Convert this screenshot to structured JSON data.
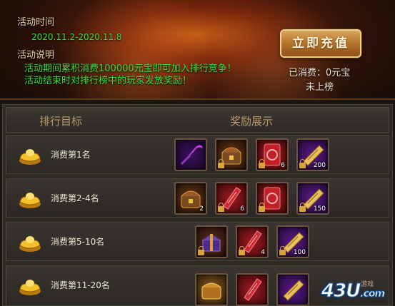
{
  "banner": {
    "time_title": "活动时间",
    "time_range": "2020.11.2-2020.11.8",
    "desc_title": "活动说明",
    "desc_line1": "活动期间累积消费100000元宝即可加入排行竞争！",
    "desc_line2": "活动结束时对排行榜中的玩家发放奖励！",
    "recharge_label": "立即充值",
    "spent_text": "已消费：0元宝",
    "rank_status": "未上榜"
  },
  "table": {
    "col_target": "排行目标",
    "col_reward": "奖励展示",
    "rows": [
      {
        "label": "消费第1名",
        "items": [
          {
            "icon": "scythe-icon",
            "count": ""
          },
          {
            "icon": "treasure-chest-icon",
            "count": ""
          },
          {
            "icon": "red-token-icon",
            "count": "6"
          },
          {
            "icon": "purple-scroll-icon",
            "count": "200"
          }
        ]
      },
      {
        "label": "消费第2-4名",
        "items": [
          {
            "icon": "treasure-chest-icon",
            "count": "2"
          },
          {
            "icon": "red-talisman-icon",
            "count": "6"
          },
          {
            "icon": "red-token-icon",
            "count": ""
          },
          {
            "icon": "purple-scroll-icon",
            "count": "150"
          }
        ]
      },
      {
        "label": "消费第5-10名",
        "items": [
          {
            "icon": "gift-box-icon",
            "count": ""
          },
          {
            "icon": "red-talisman-icon",
            "count": "4"
          },
          {
            "icon": "purple-scroll-icon",
            "count": "100"
          }
        ]
      },
      {
        "label": "消费第11-20名",
        "items": [
          {
            "icon": "golden-chest-icon",
            "count": ""
          },
          {
            "icon": "red-talisman-icon",
            "count": ""
          },
          {
            "icon": "purple-scroll-icon",
            "count": ""
          }
        ]
      }
    ]
  },
  "watermark": {
    "main": "43U",
    "suffix": ".com",
    "top": "游戏"
  }
}
